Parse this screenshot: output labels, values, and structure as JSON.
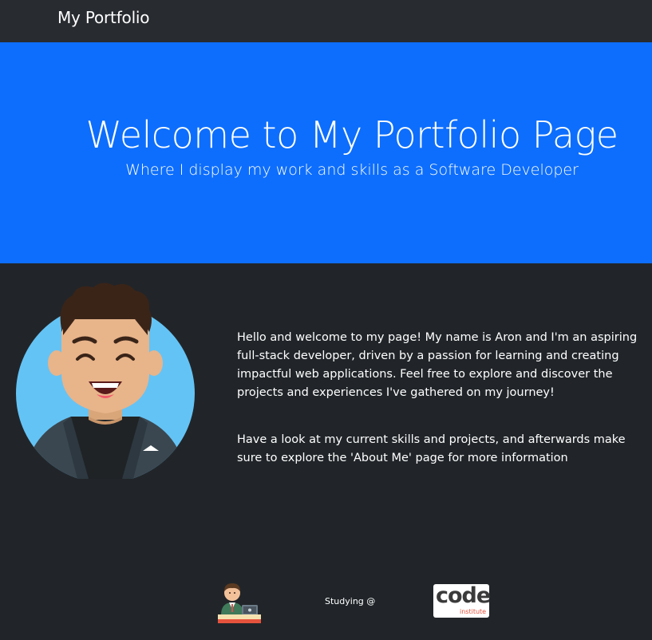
{
  "nav": {
    "brand": "My Portfolio"
  },
  "hero": {
    "title": "Welcome to My Portfolio Page",
    "subtitle": "Where I display my work and skills as a Software Developer"
  },
  "about": {
    "intro": "Hello and welcome to my page! My name is Aron and I'm an aspiring full-stack developer, driven by a passion for learning and creating impactful web applications. Feel free to explore and discover the projects and experiences I've gathered on my journey!",
    "cta": "Have a look at my current skills and projects, and afterwards make sure to explore the 'About Me' page for more information"
  },
  "footer": {
    "studying_label": "Studying @",
    "logo_word": "code",
    "logo_sub": "institute"
  },
  "icons": {
    "avatar": "developer-avatar-icon",
    "developer": "developer-at-desk-icon",
    "school_logo": "code-institute-logo"
  },
  "colors": {
    "navbar": "#282b30",
    "hero": "#0d6efd",
    "body": "#212529",
    "avatar_bg": "#64c3f5",
    "logo_accent": "#e5533d"
  }
}
